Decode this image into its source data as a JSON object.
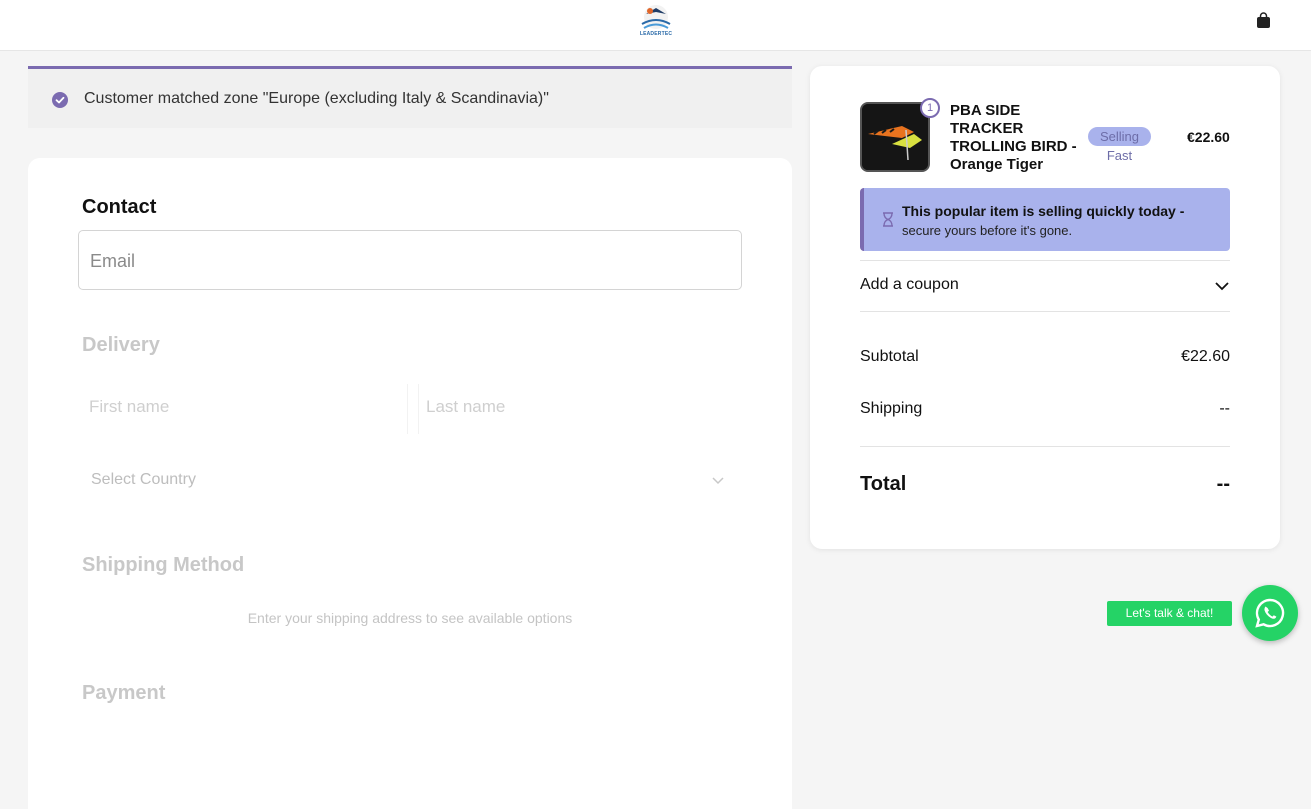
{
  "header": {
    "logo_text": "LEADERTEC",
    "cart_icon": "shopping-bag-icon"
  },
  "zone_banner": {
    "text": "Customer matched zone \"Europe (excluding Italy & Scandinavia)\"",
    "icon": "check-circle-icon"
  },
  "contact": {
    "title": "Contact",
    "email_placeholder": "Email"
  },
  "delivery": {
    "title": "Delivery",
    "first_name_placeholder": "First name",
    "last_name_placeholder": "Last name",
    "country_placeholder": "Select Country"
  },
  "shipping_method": {
    "title": "Shipping Method",
    "hint": "Enter your shipping address to see available options"
  },
  "payment": {
    "title": "Payment"
  },
  "summary": {
    "product": {
      "name": "PBA SIDE TRACKER TROLLING BIRD - Orange Tiger",
      "quantity": "1",
      "badge": "Selling Fast",
      "price": "€22.60"
    },
    "alert": {
      "strong": "This popular item is selling quickly today -",
      "rest": "secure yours before it's gone."
    },
    "coupon_label": "Add a coupon",
    "subtotal_label": "Subtotal",
    "subtotal_value": "€22.60",
    "shipping_label": "Shipping",
    "shipping_value": "--",
    "total_label": "Total",
    "total_value": "--"
  },
  "chat": {
    "label": "Let's talk & chat!"
  },
  "colors": {
    "accent": "#7b6bb0",
    "badge_bg": "#a9b2ec",
    "whatsapp": "#25d366"
  }
}
